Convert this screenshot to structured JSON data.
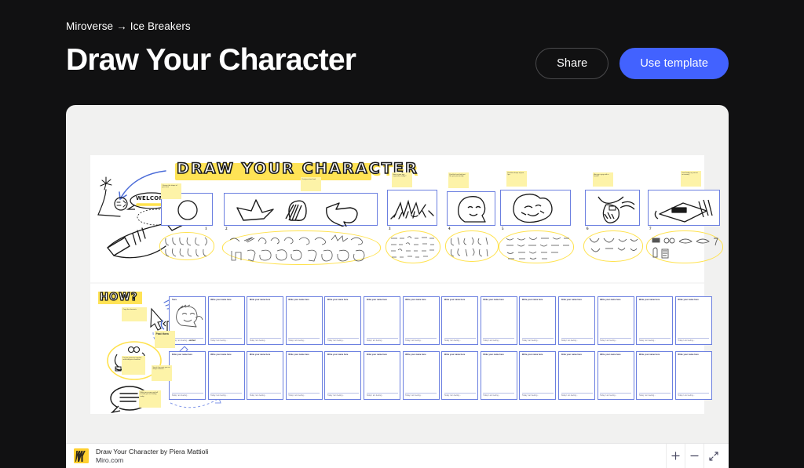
{
  "header": {
    "breadcrumb": {
      "root": "Miroverse",
      "arrow": "→",
      "current": "Ice Breakers"
    },
    "title": "Draw Your Character",
    "share_label": "Share",
    "use_template_label": "Use template"
  },
  "colors": {
    "page_background": "#111112",
    "board_background": "#f1f1f0",
    "canvas": "#ffffff",
    "accent_blue": "#4262ff",
    "sticky_yellow": "#fdf3a8",
    "highlight_yellow": "#ffe24d",
    "card_border": "#6b7fe0",
    "miro_yellow": "#ffd02f"
  },
  "board": {
    "heading": "DRAW YOUR CHARACTER",
    "welcome_bubble": "WELCOME!",
    "how_heading": "HOW?",
    "panels": [
      {
        "number": "1",
        "sticky": "Choose the shape of your face"
      },
      {
        "number": "2",
        "sticky": "Find your best look"
      },
      {
        "number": "3",
        "sticky": "How is your eye expression today?"
      },
      {
        "number": "4",
        "sticky": "Find the hair that best fits your personality"
      },
      {
        "number": "5",
        "sticky": "Find the shape of your lips"
      },
      {
        "number": "6",
        "sticky": "Are you a guy with a beard?"
      },
      {
        "number": "7",
        "sticky": "Use Friday, my secret accessory"
      }
    ],
    "how_stickies": [
      "Copy the elements",
      "Past them",
      "Put the elements together and build your character",
      "Save it if you want, you can always customise",
      "Write your name and tell us how you are feeling today"
    ],
    "card_title_placeholder": "Write your name here",
    "card_footer_placeholder": "Today I am feeling...",
    "example_card": {
      "title": "Piera",
      "footer_label": "Today I am feeling...",
      "footer_value": "excited"
    },
    "cards_per_row": 14,
    "card_rows": 2
  },
  "footer": {
    "title": "Draw Your Character by Piera Mattioli",
    "subtitle": "Miro.com",
    "controls": [
      {
        "name": "zoom-in",
        "glyph": "+"
      },
      {
        "name": "zoom-out",
        "glyph": "−"
      },
      {
        "name": "fullscreen",
        "glyph": "⤢"
      }
    ]
  }
}
